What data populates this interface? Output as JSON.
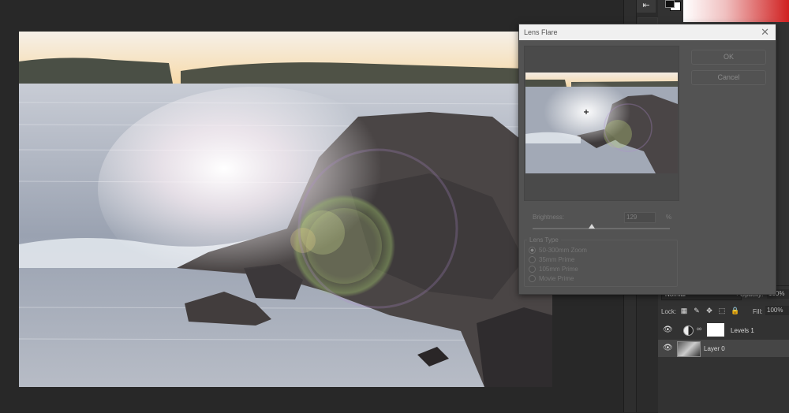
{
  "dialog": {
    "title": "Lens Flare",
    "ok_label": "OK",
    "cancel_label": "Cancel",
    "brightness_label": "Brightness:",
    "brightness_value": "129",
    "brightness_unit": "%",
    "brightness_slider_fraction": 0.43,
    "lens_type_label": "Lens Type",
    "lens_types": [
      "50-300mm Zoom",
      "35mm Prime",
      "105mm Prime",
      "Movie Prime"
    ],
    "selected_lens_type": "50-300mm Zoom"
  },
  "layers_panel": {
    "blend_mode": "Normal",
    "opacity_label": "Opacity:",
    "opacity_value": "100%",
    "lock_label": "Lock:",
    "fill_label": "Fill:",
    "fill_value": "100%",
    "layers": [
      {
        "name": "Levels 1",
        "visible": true,
        "selected": false
      },
      {
        "name": "Layer 0",
        "visible": true,
        "selected": true
      }
    ]
  },
  "colors": {
    "foreground": "#000000",
    "background": "#ffffff"
  }
}
